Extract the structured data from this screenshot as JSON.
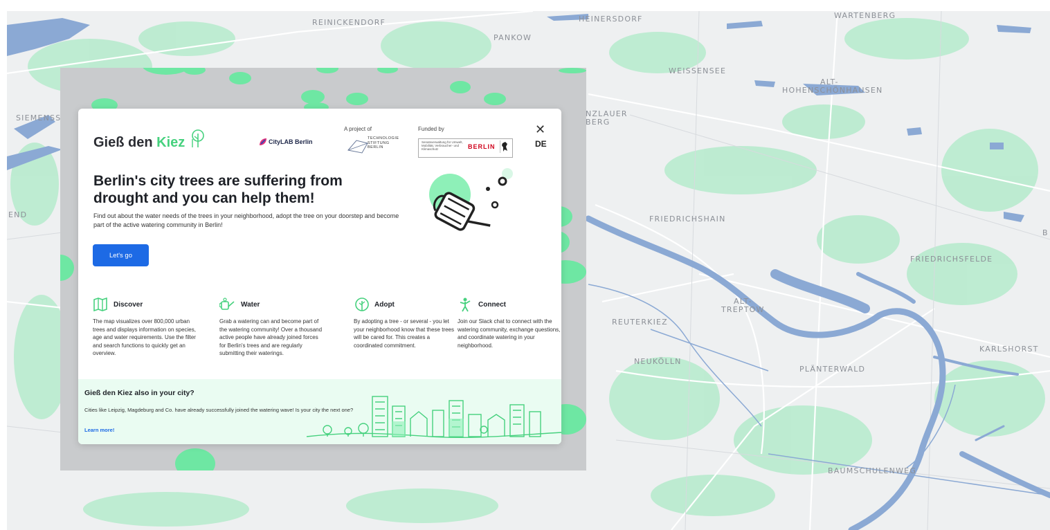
{
  "map": {
    "districts": [
      {
        "name": "REINICKENDORF"
      },
      {
        "name": "PANKOW"
      },
      {
        "name": "HEINERSDORF"
      },
      {
        "name": "WARTENBERG"
      },
      {
        "name": "WEISSENSEE"
      },
      {
        "name": "ALT-"
      },
      {
        "name": "HOHENSCHÖNHAUSEN"
      },
      {
        "name": "SIEMENSS"
      },
      {
        "name": "NZLAUER"
      },
      {
        "name": "BERG"
      },
      {
        "name": "END"
      },
      {
        "name": "FRIEDRICHSHAIN"
      },
      {
        "name": "FRIEDRICHSFELDE"
      },
      {
        "name": "ALT-"
      },
      {
        "name": "TREPTOW"
      },
      {
        "name": "REUTERKIEZ"
      },
      {
        "name": "KARLSHORST"
      },
      {
        "name": "NEUKÖLLN"
      },
      {
        "name": "PLÄNTERWALD"
      },
      {
        "name": "BAUMSCHULENWEG"
      },
      {
        "name": "B"
      }
    ],
    "colors": {
      "water": "#8ba9d4",
      "trees": "#b5ebcc",
      "land": "#eef0f1"
    }
  },
  "modal": {
    "title_part1": "Gieß den ",
    "title_part2": "Kiez",
    "close_label": "✕",
    "lang_label": "DE",
    "project_label": "A project of",
    "funded_label": "Funded by",
    "citylab_label": "CityLAB Berlin",
    "tsb_label": "TECHNOLOGIE STIFTUNG BERLIN",
    "senate_label": "Senatsverwaltung für Umwelt, Mobilität, Verbraucher- und Klimaschutz",
    "berlin_label": "BERLIN",
    "headline": "Berlin's city trees are suffering from drought and you can help them!",
    "lead": "Find out about the water needs of the trees in your neighborhood, adopt the tree on your doorstep and become part of the active watering community in Berlin!",
    "cta_label": "Let's go",
    "features": [
      {
        "icon": "map-icon",
        "title": "Discover",
        "text": "The map visualizes over 800,000 urban trees and displays information on species, age and water requirements. Use the filter and search functions to quickly get an overview."
      },
      {
        "icon": "watering-can-icon",
        "title": "Water",
        "text": "Grab a watering can and become part of the watering community! Over a thousand active people have already joined forces for Berlin's trees and are regularly submitting their waterings."
      },
      {
        "icon": "tree-icon",
        "title": "Adopt",
        "text": "By adopting a tree - or several - you let your neighborhood know that these trees will be cared for. This creates a coordinated commitment."
      },
      {
        "icon": "person-icon",
        "title": "Connect",
        "text": "Join our Slack chat to connect with the watering community, exchange questions, and coordinate watering in your neighborhood."
      }
    ],
    "footer": {
      "title": "Gieß den Kiez also in your city?",
      "text": "Cities like Leipzig, Magdeburg and Co. have already successfully joined the watering wave! Is your city the next one?",
      "link": "Learn more!"
    },
    "accent_green": "#46d17e",
    "accent_blue": "#1d6ae5"
  }
}
